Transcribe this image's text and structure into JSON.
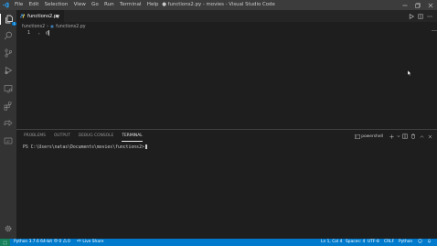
{
  "menu": [
    "File",
    "Edit",
    "Selection",
    "View",
    "Go",
    "Run",
    "Terminal",
    "Help"
  ],
  "window_title": "● functions2.py - movies - Visual Studio Code",
  "activity_badge": "1",
  "tab": {
    "label": "functions2.py"
  },
  "breadcrumb": {
    "folder": "functions2",
    "file": "functions2.py"
  },
  "editor": {
    "line_number": "1",
    "code": "d"
  },
  "panel": {
    "tabs": [
      "PROBLEMS",
      "OUTPUT",
      "DEBUG CONSOLE",
      "TERMINAL"
    ],
    "active_tab": "TERMINAL",
    "terminal_name": "powershell",
    "terminal_prompt": "PS C:\\Users\\natas\\Documents\\movies\\functions2>"
  },
  "status": {
    "python": "Python 3.7.6 64-bit",
    "errors": "0",
    "warnings": "0",
    "live_share": "Live Share",
    "position": "Ln 1, Col 4",
    "spaces": "Spaces: 4",
    "encoding": "UTF-8",
    "eol": "CRLF",
    "language": "Python"
  },
  "colors": {
    "accent": "#007acc",
    "remote": "#16825d",
    "python_file": "#3c78aa"
  }
}
